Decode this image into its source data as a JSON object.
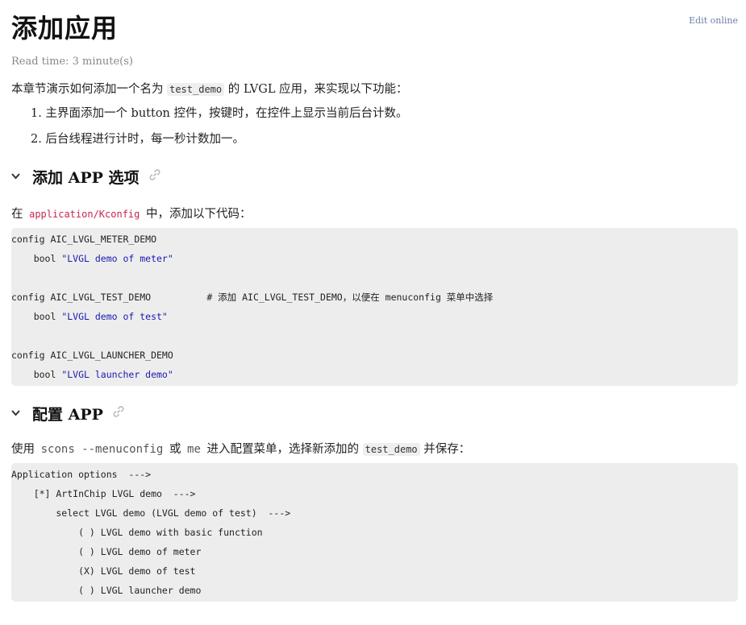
{
  "title": "添加应用",
  "edit_online": "Edit online",
  "read_time": "Read time: 3 minute(s)",
  "intro": {
    "before": "本章节演示如何添加一个名为",
    "code": "test_demo",
    "after": "的 LVGL 应用，来实现以下功能："
  },
  "list": [
    "1. 主界面添加一个 button 控件，按键时，在控件上显示当前后台计数。",
    "2. 后台线程进行计时，每一秒计数加一。"
  ],
  "section1": {
    "heading": "添加 APP 选项",
    "para_before": "在",
    "para_code": "application/Kconfig",
    "para_after": "中，添加以下代码：",
    "code_lines": [
      {
        "text": "config AIC_LVGL_METER_DEMO",
        "str": ""
      },
      {
        "text": "    bool ",
        "str": "\"LVGL demo of meter\""
      },
      {
        "text": "",
        "str": ""
      },
      {
        "text": "config AIC_LVGL_TEST_DEMO          # 添加 AIC_LVGL_TEST_DEMO，以便在 menuconfig 菜单中选择",
        "str": ""
      },
      {
        "text": "    bool ",
        "str": "\"LVGL demo of test\""
      },
      {
        "text": "",
        "str": ""
      },
      {
        "text": "config AIC_LVGL_LAUNCHER_DEMO",
        "str": ""
      },
      {
        "text": "    bool ",
        "str": "\"LVGL launcher demo\""
      }
    ]
  },
  "section2": {
    "heading": "配置 APP",
    "para_1": "使用",
    "para_code1": "scons --menuconfig",
    "para_2": "或",
    "para_code2": "me",
    "para_3": "进入配置菜单，选择新添加的",
    "para_code3": "test_demo",
    "para_4": "并保存：",
    "code_lines": [
      "Application options  --->",
      "    [*] ArtInChip LVGL demo  --->",
      "        select LVGL demo (LVGL demo of test)  --->",
      "            ( ) LVGL demo with basic function",
      "            ( ) LVGL demo of meter",
      "            (X) LVGL demo of test",
      "            ( ) LVGL launcher demo"
    ]
  },
  "colors": {
    "string": "#1a1ab0",
    "inline_code_red": "#c7254e",
    "code_bg": "#ededed",
    "edit_link": "#6b7fa8"
  },
  "icons": {
    "chevron": "chevron-down-icon",
    "link": "link-icon"
  }
}
